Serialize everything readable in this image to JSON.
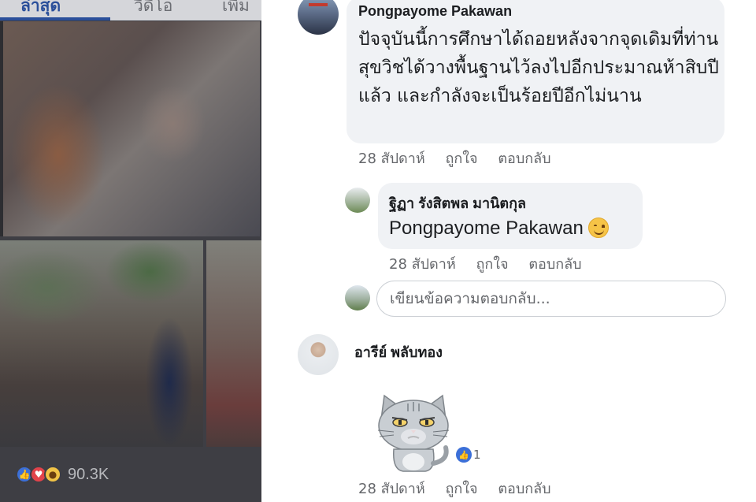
{
  "left_panel": {
    "tabs": [
      {
        "label": "ล่าสุด",
        "active": true
      },
      {
        "label": "วิดีโอ",
        "active": false
      },
      {
        "label": "เพิ่ม",
        "active": false
      }
    ],
    "reactions": {
      "icons": [
        "like-icon",
        "love-icon",
        "wow-icon"
      ],
      "count": "90.3K"
    }
  },
  "comments": [
    {
      "author": "Pongpayome Pakawan",
      "text": "ปัจจุบันนี้การศึกษาได้ถอยหลังจากจุดเดิมที่ท่านสุขวิชได้วางพื้นฐานไว้ลงไปอีกประมาณห้าสิบปีแล้ว และกำลังจะเป็นร้อยปีอีกไม่นาน",
      "time": "28 สัปดาห์",
      "like_label": "ถูกใจ",
      "reply_label": "ตอบกลับ",
      "reply": {
        "author": "ฐิฏา  รังสิตพล  มานิตกุล",
        "text": "Pongpayome Pakawan",
        "emoji": "smile-emoji",
        "time": "28 สัปดาห์",
        "like_label": "ถูกใจ",
        "reply_label": "ตอบกลับ"
      }
    },
    {
      "author": "อารีย์ พลับทอง",
      "sticker": "grumpy-cat-sticker",
      "sticker_likes": "1",
      "time": "28 สัปดาห์",
      "like_label": "ถูกใจ",
      "reply_label": "ตอบกลับ"
    }
  ],
  "reply_input": {
    "placeholder": "เขียนข้อความตอบกลับ..."
  },
  "colors": {
    "bubble": "#f0f2f5",
    "meta_text": "#65676b",
    "link_blue": "#2a4f9a",
    "like_blue": "#3b6fd8"
  }
}
